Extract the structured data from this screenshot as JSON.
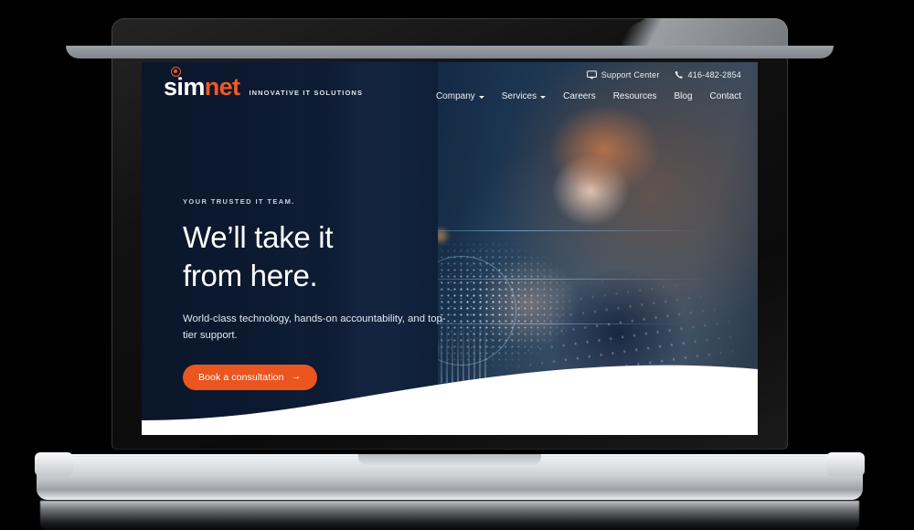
{
  "device": {
    "type": "laptop-mockup",
    "frame_color": "#1a1a1a",
    "base_color": "#cfd2d6"
  },
  "site": {
    "brand": {
      "name_part1": "sim",
      "name_part2": "net",
      "tagline": "INNOVATIVE IT SOLUTIONS",
      "mark_icon": "target-circle-icon",
      "accent_color": "#ef5a23"
    },
    "topbar": {
      "support": {
        "icon": "monitor-icon",
        "label": "Support Center"
      },
      "phone": {
        "icon": "phone-icon",
        "label": "416-482-2854"
      }
    },
    "nav": {
      "items": [
        {
          "label": "Company",
          "has_dropdown": true,
          "icon": "chevron-down-icon"
        },
        {
          "label": "Services",
          "has_dropdown": true,
          "icon": "chevron-down-icon"
        },
        {
          "label": "Careers",
          "has_dropdown": false
        },
        {
          "label": "Resources",
          "has_dropdown": false
        },
        {
          "label": "Blog",
          "has_dropdown": false
        },
        {
          "label": "Contact",
          "has_dropdown": false
        }
      ]
    },
    "hero": {
      "eyebrow": "YOUR TRUSTED IT TEAM.",
      "headline_line1": "We’ll take it",
      "headline_line2": "from here.",
      "subtext": "World-class technology, hands-on accountability, and top-tier support.",
      "cta_label": "Book a consultation",
      "cta_arrow": "→",
      "cta_color": "#ea5520",
      "background_color": "#0e1f3c"
    }
  }
}
